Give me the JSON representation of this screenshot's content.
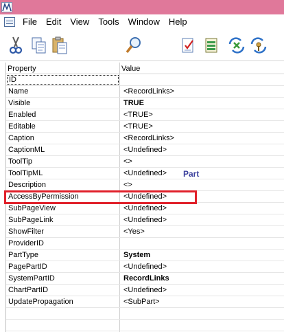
{
  "menu": {
    "items": [
      "File",
      "Edit",
      "View",
      "Tools",
      "Window",
      "Help"
    ]
  },
  "toolbar": {
    "icons": [
      "scissors-icon",
      "copy-icon",
      "paste-icon",
      "find-icon",
      "properties-icon",
      "run-icon",
      "refresh-icon",
      "permissions-icon"
    ]
  },
  "grid": {
    "header_property": "Property",
    "header_value": "Value",
    "rows": [
      {
        "name": "ID",
        "value": ""
      },
      {
        "name": "Name",
        "value": "<RecordLinks>"
      },
      {
        "name": "Visible",
        "value": "TRUE"
      },
      {
        "name": "Enabled",
        "value": "<TRUE>"
      },
      {
        "name": "Editable",
        "value": "<TRUE>"
      },
      {
        "name": "Caption",
        "value": "<RecordLinks>"
      },
      {
        "name": "CaptionML",
        "value": "<Undefined>"
      },
      {
        "name": "ToolTip",
        "value": "<>"
      },
      {
        "name": "ToolTipML",
        "value": "<Undefined>"
      },
      {
        "name": "Description",
        "value": "<>"
      },
      {
        "name": "AccessByPermission",
        "value": "<Undefined>"
      },
      {
        "name": "SubPageView",
        "value": "<Undefined>"
      },
      {
        "name": "SubPageLink",
        "value": "<Undefined>"
      },
      {
        "name": "ShowFilter",
        "value": "<Yes>"
      },
      {
        "name": "ProviderID",
        "value": ""
      },
      {
        "name": "PartType",
        "value": "System"
      },
      {
        "name": "PagePartID",
        "value": "<Undefined>"
      },
      {
        "name": "SystemPartID",
        "value": "RecordLinks"
      },
      {
        "name": "ChartPartID",
        "value": "<Undefined>"
      },
      {
        "name": "UpdatePropagation",
        "value": "<SubPart>"
      }
    ],
    "part_label": "Part"
  },
  "colors": {
    "titlebar": "#e0789a",
    "highlight": "#e0202a",
    "part_label": "#3a3f9c"
  }
}
